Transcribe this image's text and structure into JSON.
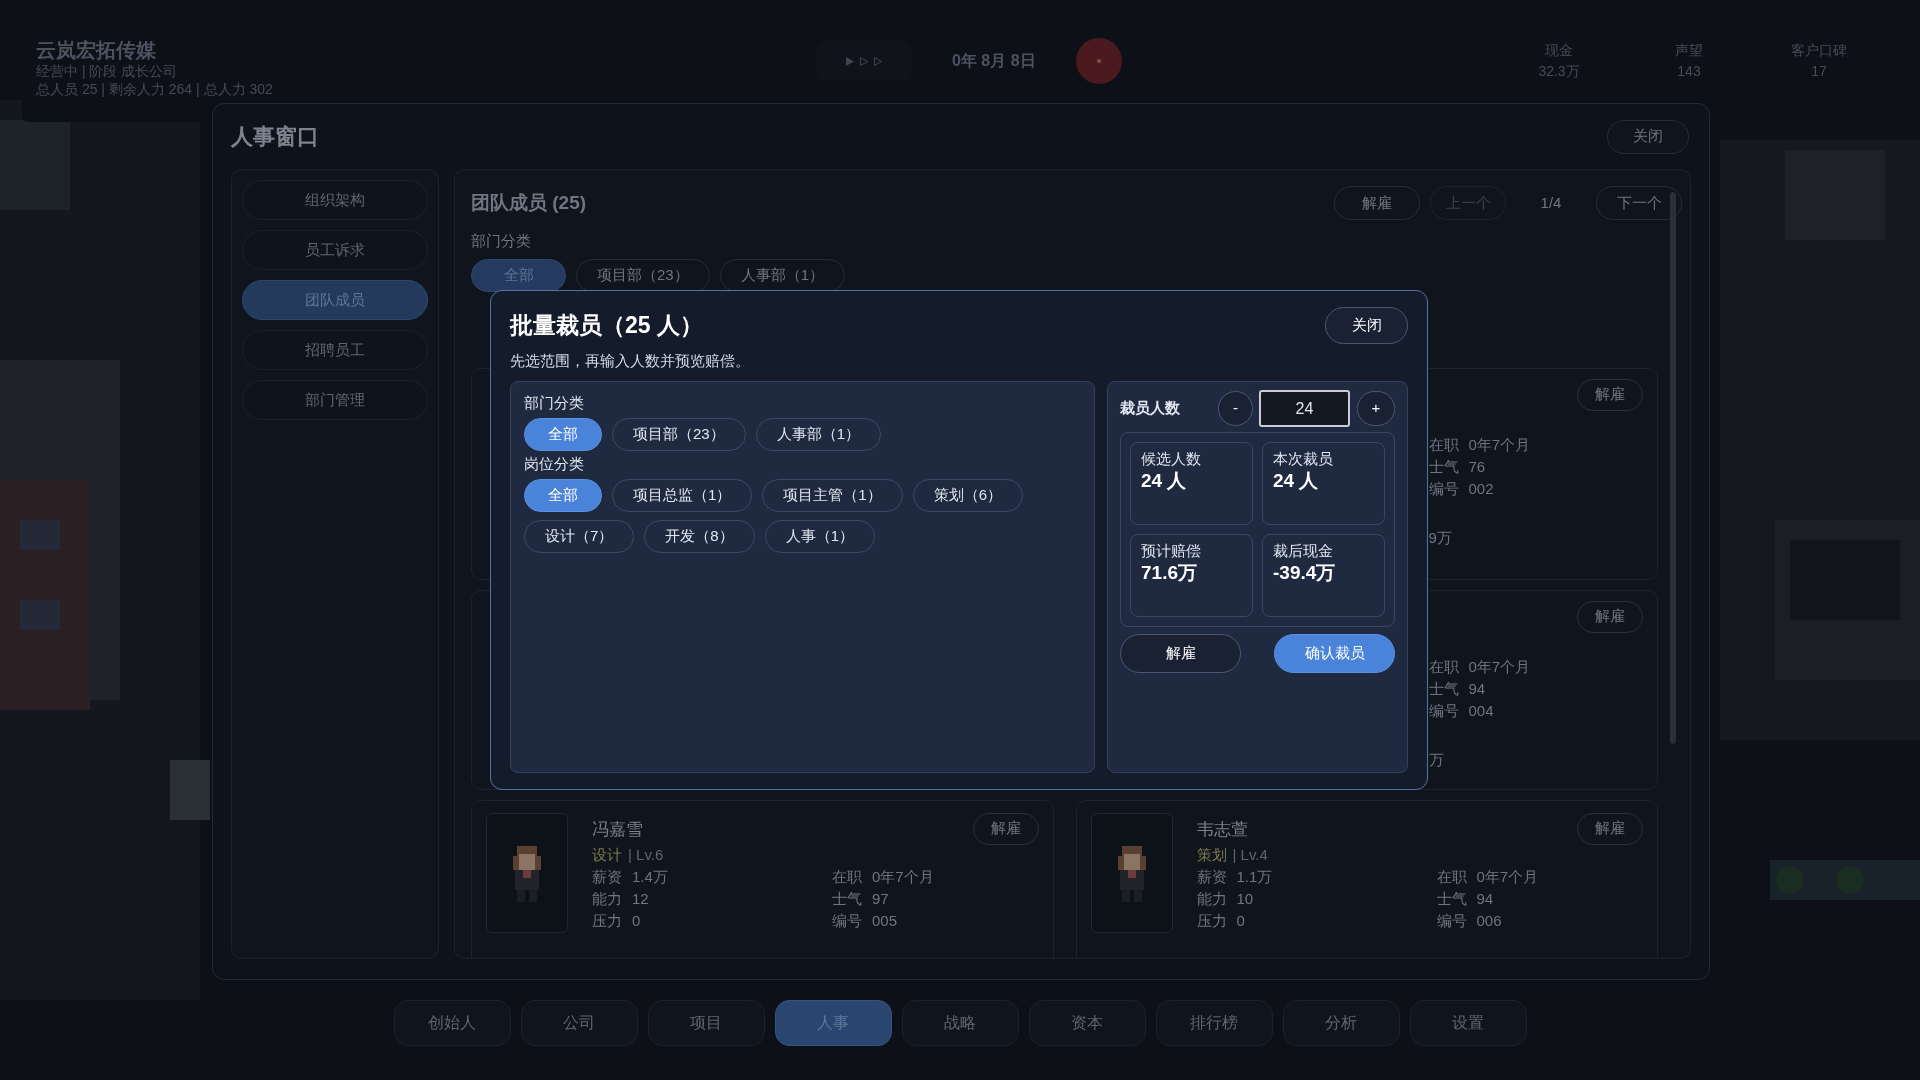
{
  "top_bar": {
    "company": "云岚宏拓传媒",
    "status": "经营中 | 阶段 成长公司",
    "summary": "总人员 25 | 剩余人力 264 | 总人力 302",
    "date": "0年 8月 8日",
    "stats": [
      {
        "label": "现金",
        "value": "32.3万"
      },
      {
        "label": "声望",
        "value": "143"
      },
      {
        "label": "客户口碑",
        "value": "17"
      }
    ]
  },
  "window": {
    "title": "人事窗口",
    "close": "关闭"
  },
  "sidebar": {
    "items": [
      {
        "label": "组织架构",
        "selected": false
      },
      {
        "label": "员工诉求",
        "selected": false
      },
      {
        "label": "团队成员",
        "selected": true
      },
      {
        "label": "招聘员工",
        "selected": false
      },
      {
        "label": "部门管理",
        "selected": false
      }
    ]
  },
  "team": {
    "title": "团队成员 (25)",
    "dismiss": "解雇",
    "prev": {
      "label": "上一个",
      "disabled": true
    },
    "page": "1/4",
    "next": {
      "label": "下一个",
      "disabled": false
    },
    "department_label": "部门分类",
    "department_chips": [
      {
        "label": "全部",
        "selected": true
      },
      {
        "label": "项目部（23）",
        "selected": false
      },
      {
        "label": "人事部（1）",
        "selected": false
      }
    ],
    "members": [
      {
        "kind": "covered",
        "dismiss": "解雇",
        "stats": [
          {
            "label": "在职",
            "value": "0年7个月"
          },
          {
            "label": "士气",
            "value": "76"
          },
          {
            "label": "编号",
            "value": "002"
          }
        ],
        "extra": "9万"
      },
      {
        "kind": "covered",
        "dismiss": "解雇",
        "stats": [
          {
            "label": "在职",
            "value": "0年7个月"
          },
          {
            "label": "士气",
            "value": "94"
          },
          {
            "label": "编号",
            "value": "004"
          }
        ],
        "extra": "万"
      },
      {
        "kind": "full",
        "name": "冯嘉雪",
        "role": "设计",
        "level": "| Lv.6",
        "dismiss": "解雇",
        "left": [
          {
            "label": "薪资",
            "value": "1.4万"
          },
          {
            "label": "能力",
            "value": "12"
          },
          {
            "label": "压力",
            "value": "0"
          }
        ],
        "stats": [
          {
            "label": "在职",
            "value": "0年7个月"
          },
          {
            "label": "士气",
            "value": "97"
          },
          {
            "label": "编号",
            "value": "005"
          }
        ]
      },
      {
        "kind": "full",
        "name": "韦志萱",
        "role": "策划",
        "level": "| Lv.4",
        "dismiss": "解雇",
        "left": [
          {
            "label": "薪资",
            "value": "1.1万"
          },
          {
            "label": "能力",
            "value": "10"
          },
          {
            "label": "压力",
            "value": "0"
          }
        ],
        "stats": [
          {
            "label": "在职",
            "value": "0年7个月"
          },
          {
            "label": "士气",
            "value": "94"
          },
          {
            "label": "编号",
            "value": "006"
          }
        ]
      }
    ]
  },
  "modal": {
    "title": "批量裁员（25 人）",
    "close": "关闭",
    "hint": "先选范围，再输入人数并预览赔偿。",
    "filters": [
      {
        "label": "部门分类",
        "chips": [
          {
            "label": "全部",
            "selected": true
          },
          {
            "label": "项目部（23）",
            "selected": false
          },
          {
            "label": "人事部（1）",
            "selected": false
          }
        ]
      },
      {
        "label": "岗位分类",
        "chips": [
          {
            "label": "全部",
            "selected": true
          },
          {
            "label": "项目总监（1）",
            "selected": false
          },
          {
            "label": "项目主管（1）",
            "selected": false
          },
          {
            "label": "策划（6）",
            "selected": false
          },
          {
            "label": "设计（7）",
            "selected": false
          },
          {
            "label": "开发（8）",
            "selected": false
          },
          {
            "label": "人事（1）",
            "selected": false
          }
        ]
      }
    ],
    "count": {
      "label": "裁员人数",
      "minus": "-",
      "value": "24",
      "plus": "+"
    },
    "stats": [
      {
        "label": "候选人数",
        "value": "24 人"
      },
      {
        "label": "本次裁员",
        "value": "24 人"
      },
      {
        "label": "预计赔偿",
        "value": "71.6万"
      },
      {
        "label": "裁后现金",
        "value": "-39.4万"
      }
    ],
    "buttons": [
      {
        "label": "解雇",
        "kind": "secondary"
      },
      {
        "label": "确认裁员",
        "kind": "primary"
      }
    ]
  },
  "nav": [
    {
      "label": "创始人",
      "selected": false
    },
    {
      "label": "公司",
      "selected": false
    },
    {
      "label": "项目",
      "selected": false
    },
    {
      "label": "人事",
      "selected": true
    },
    {
      "label": "战略",
      "selected": false
    },
    {
      "label": "资本",
      "selected": false
    },
    {
      "label": "排行榜",
      "selected": false
    },
    {
      "label": "分析",
      "selected": false
    },
    {
      "label": "设置",
      "selected": false
    }
  ]
}
